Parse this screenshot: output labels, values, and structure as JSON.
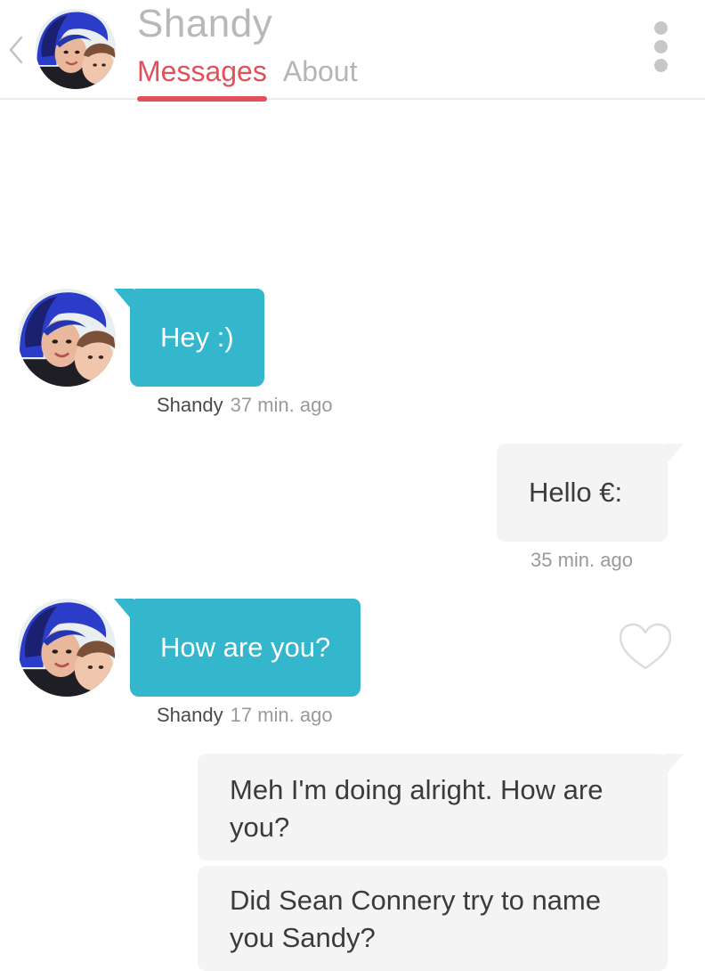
{
  "header": {
    "name": "Shandy",
    "tabs": [
      {
        "label": "Messages",
        "active": true
      },
      {
        "label": "About",
        "active": false
      }
    ],
    "accent_color": "#e2505a"
  },
  "messages": [
    {
      "direction": "incoming",
      "text": "Hey :)",
      "sender": "Shandy",
      "time": "37 min. ago"
    },
    {
      "direction": "outgoing",
      "text": "Hello €:",
      "time": "35 min. ago"
    },
    {
      "direction": "incoming",
      "text": "How are you?",
      "sender": "Shandy",
      "time": "17 min. ago"
    },
    {
      "direction": "outgoing",
      "text": "Meh I'm doing alright. How are you?"
    },
    {
      "direction": "outgoing",
      "text": "Did Sean Connery try to name you Sandy?"
    }
  ],
  "colors": {
    "incoming_bubble": "#34b6cd",
    "outgoing_bubble": "#f4f4f4"
  },
  "icons": {
    "back": "chevron-left-icon",
    "more": "more-vertical-icon",
    "like": "heart-outline-icon"
  }
}
